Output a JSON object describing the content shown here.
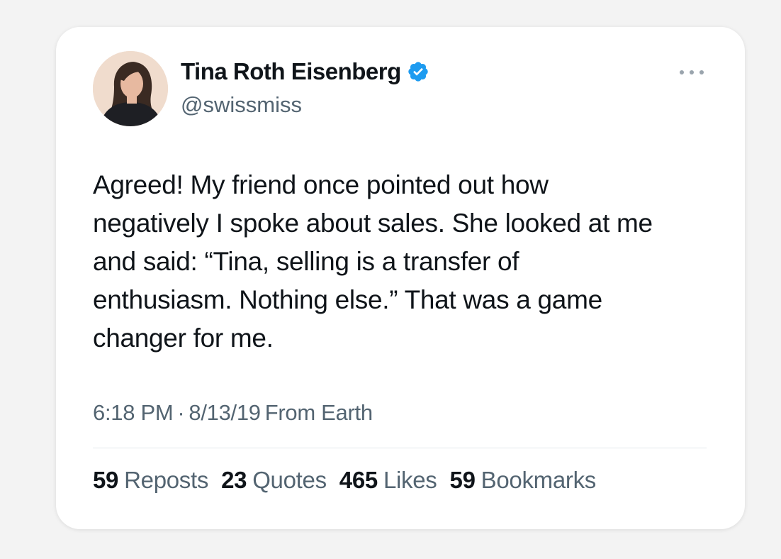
{
  "tweet": {
    "author": {
      "display_name": "Tina Roth Eisenberg",
      "handle": "@swissmiss",
      "verified": true,
      "avatar_icon": "profile-photo"
    },
    "text_lines": [
      "Agreed! My friend once pointed out how",
      "negatively I spoke about sales. She looked at me",
      "and said: “Tina, selling is a transfer of",
      "enthusiasm. Nothing else.” That was a game",
      "changer for me."
    ],
    "time": "6:18 PM",
    "separator": "·",
    "date": "8/13/19",
    "source": "From Earth",
    "stats": {
      "reposts": {
        "count": "59",
        "label": "Reposts"
      },
      "quotes": {
        "count": "23",
        "label": "Quotes"
      },
      "likes": {
        "count": "465",
        "label": "Likes"
      },
      "bookmarks": {
        "count": "59",
        "label": "Bookmarks"
      }
    }
  },
  "colors": {
    "background": "#f3f3f3",
    "card": "#ffffff",
    "primary_text": "#0f1419",
    "secondary_text": "#536471",
    "verified_blue": "#1d9bf0"
  }
}
